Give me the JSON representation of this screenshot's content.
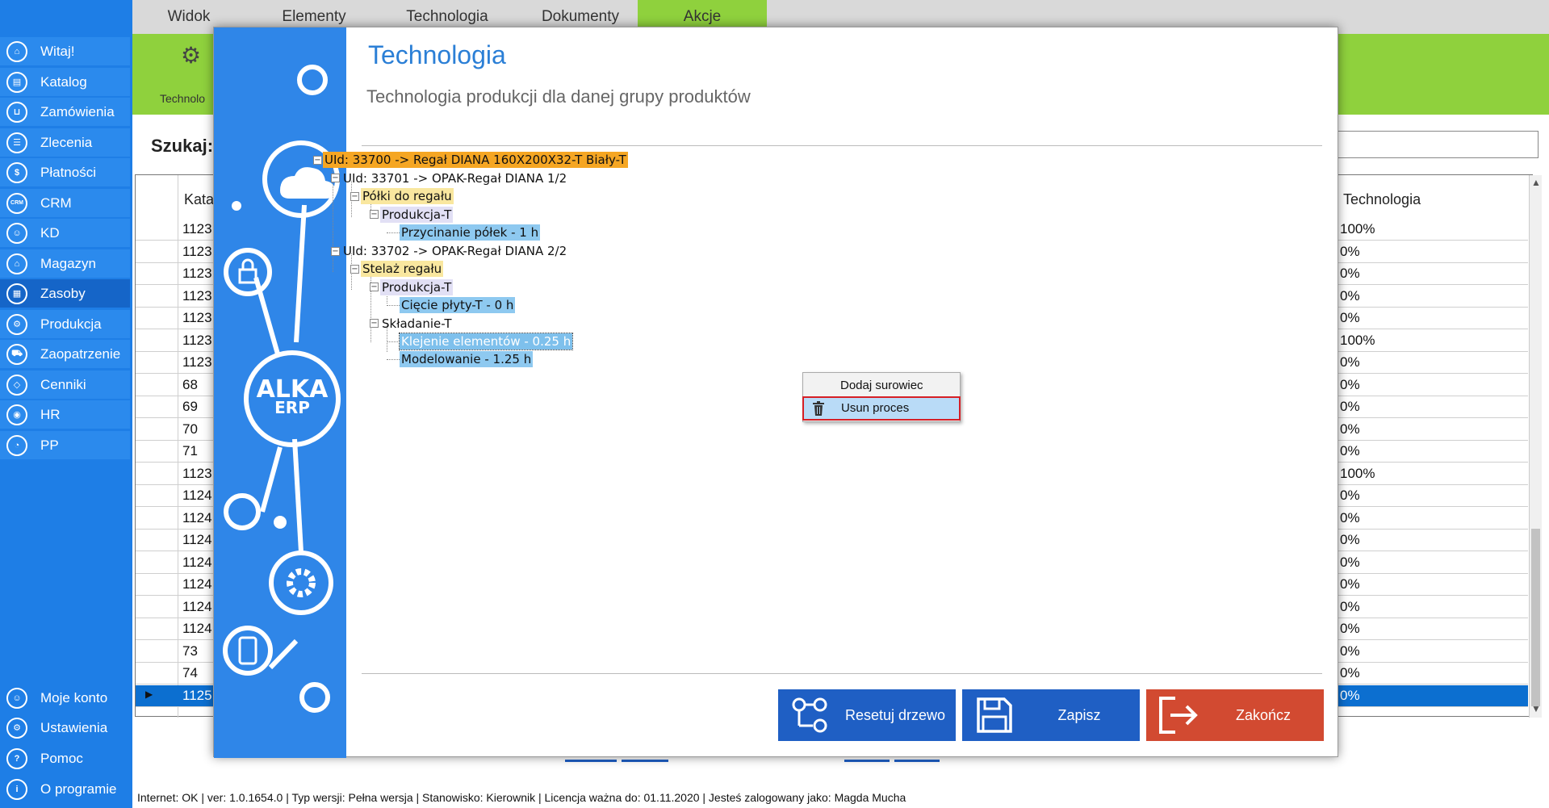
{
  "sidebar": {
    "items": [
      {
        "label": "Witaj!",
        "icon": "home-icon",
        "glyph": "⌂"
      },
      {
        "label": "Katalog",
        "icon": "book-icon",
        "glyph": "▤"
      },
      {
        "label": "Zamówienia",
        "icon": "cart-icon",
        "glyph": "⊔"
      },
      {
        "label": "Zlecenia",
        "icon": "list-icon",
        "glyph": "☰"
      },
      {
        "label": "Płatności",
        "icon": "dollar-icon",
        "glyph": "$"
      },
      {
        "label": "CRM",
        "icon": "crm-icon",
        "glyph": "CRM"
      },
      {
        "label": "KD",
        "icon": "person-icon",
        "glyph": "☺"
      },
      {
        "label": "Magazyn",
        "icon": "warehouse-icon",
        "glyph": "⌂"
      },
      {
        "label": "Zasoby",
        "icon": "resources-icon",
        "glyph": "▦"
      },
      {
        "label": "Produkcja",
        "icon": "production-icon",
        "glyph": "⚙"
      },
      {
        "label": "Zaopatrzenie",
        "icon": "supply-icon",
        "glyph": "⛟"
      },
      {
        "label": "Cenniki",
        "icon": "tag-icon",
        "glyph": "◇"
      },
      {
        "label": "HR",
        "icon": "hr-icon",
        "glyph": "◉"
      },
      {
        "label": "PP",
        "icon": "chart-icon",
        "glyph": "◔"
      }
    ],
    "bottom_items": [
      {
        "label": "Moje konto",
        "icon": "user-icon",
        "glyph": "☺"
      },
      {
        "label": "Ustawienia",
        "icon": "settings-icon",
        "glyph": "⚙"
      },
      {
        "label": "Pomoc",
        "icon": "help-icon",
        "glyph": "?"
      },
      {
        "label": "O programie",
        "icon": "info-icon",
        "glyph": "i"
      }
    ]
  },
  "ribbon": {
    "tabs": [
      "Widok",
      "Elementy",
      "Technologia",
      "Dokumenty",
      "Akcje"
    ],
    "active_tab": "Akcje",
    "button_label": "Technolo"
  },
  "search": {
    "label": "Szukaj:"
  },
  "grid": {
    "col_left_header": "Kata",
    "col_right_header": "Technologia",
    "rows": [
      {
        "a": "1123",
        "b": "100%"
      },
      {
        "a": "1123",
        "b": "0%"
      },
      {
        "a": "1123",
        "b": "0%"
      },
      {
        "a": "1123",
        "b": "0%"
      },
      {
        "a": "1123",
        "b": "0%"
      },
      {
        "a": "1123",
        "b": "100%"
      },
      {
        "a": "1123",
        "b": "0%"
      },
      {
        "a": "68",
        "b": "0%"
      },
      {
        "a": "69",
        "b": "0%"
      },
      {
        "a": "70",
        "b": "0%"
      },
      {
        "a": "71",
        "b": "0%"
      },
      {
        "a": "1123",
        "b": "100%"
      },
      {
        "a": "1124",
        "b": "0%"
      },
      {
        "a": "1124",
        "b": "0%"
      },
      {
        "a": "1124",
        "b": "0%"
      },
      {
        "a": "1124",
        "b": "0%"
      },
      {
        "a": "1124",
        "b": "0%"
      },
      {
        "a": "1124",
        "b": "0%"
      },
      {
        "a": "1124",
        "b": "0%"
      },
      {
        "a": "73",
        "b": "0%"
      },
      {
        "a": "74",
        "b": "0%"
      },
      {
        "a": "1125",
        "b": "0%"
      }
    ]
  },
  "status": {
    "text": "Internet: OK  |   ver: 1.0.1654.0   |   Typ wersji: Pełna wersja   |   Stanowisko: Kierownik   |   Licencja ważna do: 01.11.2020  |   Jesteś zalogowany jako: Magda Mucha"
  },
  "dialog": {
    "title": "Technologia",
    "subtitle": "Technologia produkcji dla danej grupy produktów",
    "brand_line1": "ALKA",
    "brand_line2": "ERP",
    "tree": {
      "n1": "UId: 33700 -> Regał DIANA 160X200X32-T Biały-T",
      "n2": "UId: 33701 -> OPAK-Regał DIANA   1/2",
      "n3": "Półki do regału",
      "n4": "Produkcja-T",
      "n5": "Przycinanie półek - 1 h",
      "n6": "UId: 33702 -> OPAK-Regał DIANA   2/2",
      "n7": "Stelaż regału",
      "n8": "Produkcja-T",
      "n9": "Cięcie płyty-T - 0 h",
      "n10": "Składanie-T",
      "n11": "Klejenie elementów - 0.25 h",
      "n12": "Modelowanie - 1.25 h"
    },
    "context_menu": {
      "item1": "Dodaj surowiec",
      "item2": "Usun proces"
    },
    "buttons": {
      "reset": "Resetuj drzewo",
      "save": "Zapisz",
      "close": "Zakończ"
    },
    "colors": {
      "reset_bg": "#1f5fc4",
      "save_bg": "#1f5fc4",
      "close_bg": "#d24a31"
    }
  }
}
